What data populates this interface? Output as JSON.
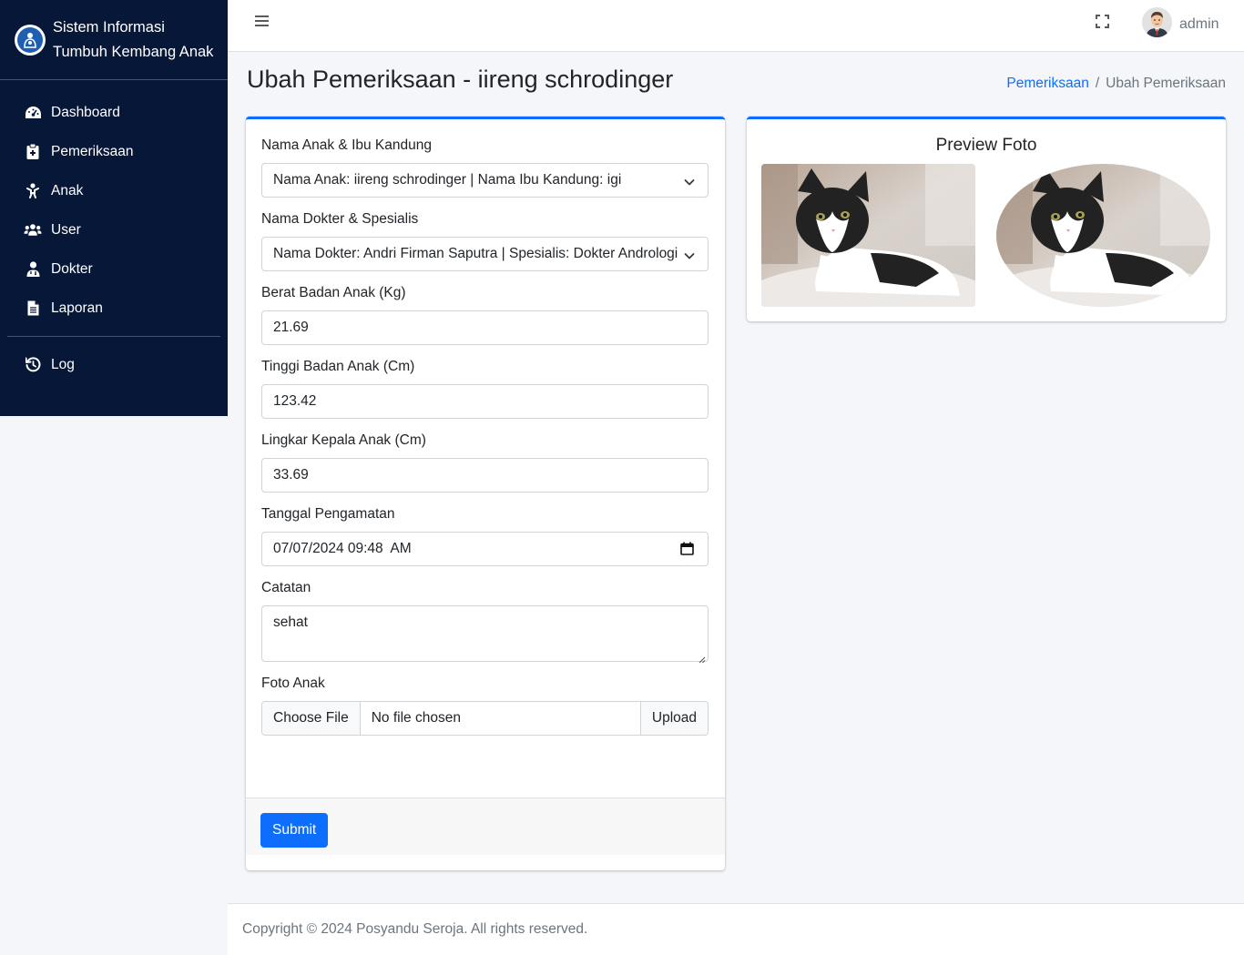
{
  "brand": {
    "line1": "Sistem Informasi",
    "line2": "Tumbuh Kembang Anak"
  },
  "sidebar": {
    "items": [
      {
        "label": "Dashboard",
        "icon": "gauge-icon"
      },
      {
        "label": "Pemeriksaan",
        "icon": "clipboard-icon"
      },
      {
        "label": "Anak",
        "icon": "baby-icon"
      },
      {
        "label": "User",
        "icon": "users-icon"
      },
      {
        "label": "Dokter",
        "icon": "doctor-icon"
      },
      {
        "label": "Laporan",
        "icon": "file-icon"
      }
    ],
    "log": {
      "label": "Log",
      "icon": "history-icon"
    }
  },
  "topbar": {
    "user": "admin"
  },
  "page": {
    "title": "Ubah Pemeriksaan - iireng schrodinger"
  },
  "breadcrumb": {
    "parent": "Pemeriksaan",
    "current": "Ubah Pemeriksaan"
  },
  "form": {
    "anak": {
      "label": "Nama Anak & Ibu Kandung",
      "value": "Nama Anak: iireng schrodinger | Nama Ibu Kandung: igi"
    },
    "dokter": {
      "label": "Nama Dokter & Spesialis",
      "value": "Nama Dokter: Andri Firman Saputra | Spesialis: Dokter Andrologi"
    },
    "berat": {
      "label": "Berat Badan Anak (Kg)",
      "value": "21.69"
    },
    "tinggi": {
      "label": "Tinggi Badan Anak (Cm)",
      "value": "123.42"
    },
    "lingkar": {
      "label": "Lingkar Kepala Anak (Cm)",
      "value": "33.69"
    },
    "tanggal": {
      "label": "Tanggal Pengamatan",
      "value": "07/07/2024 09:48  AM"
    },
    "catatan": {
      "label": "Catatan",
      "value": "sehat"
    },
    "foto": {
      "label": "Foto Anak",
      "choose": "Choose File",
      "filename": "No file chosen",
      "upload": "Upload"
    },
    "submit": "Submit"
  },
  "preview": {
    "title": "Preview Foto"
  },
  "footer": {
    "text": "Copyright © 2024 Posyandu Seroja. All rights reserved."
  },
  "colors": {
    "sidebar": "#071738",
    "primary": "#0d6efd",
    "background": "#f4f6f9"
  }
}
